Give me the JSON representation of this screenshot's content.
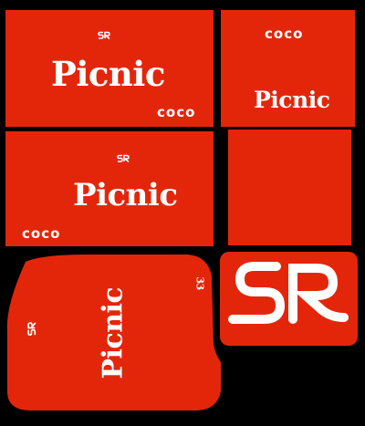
{
  "colors": {
    "brand_red": "#e3260a",
    "background": "#000000",
    "ink": "#ffffff"
  },
  "brand": {
    "wordmark": "Picnic",
    "partner": "coco",
    "monogram_icon": "sfr-monogram-icon"
  },
  "panels": [
    {
      "id": "card-large-top",
      "word": "Picnic",
      "partner": "coco"
    },
    {
      "id": "card-small-top",
      "word": "Picnic",
      "partner": "coco"
    },
    {
      "id": "card-large-middle",
      "word": "Picnic",
      "partner": "coco"
    },
    {
      "id": "card-plain",
      "word": ""
    },
    {
      "id": "pouch-shape",
      "word": "Picnic",
      "side_mark": "33"
    },
    {
      "id": "monogram-card",
      "icon": "sfr-monogram-icon"
    }
  ]
}
